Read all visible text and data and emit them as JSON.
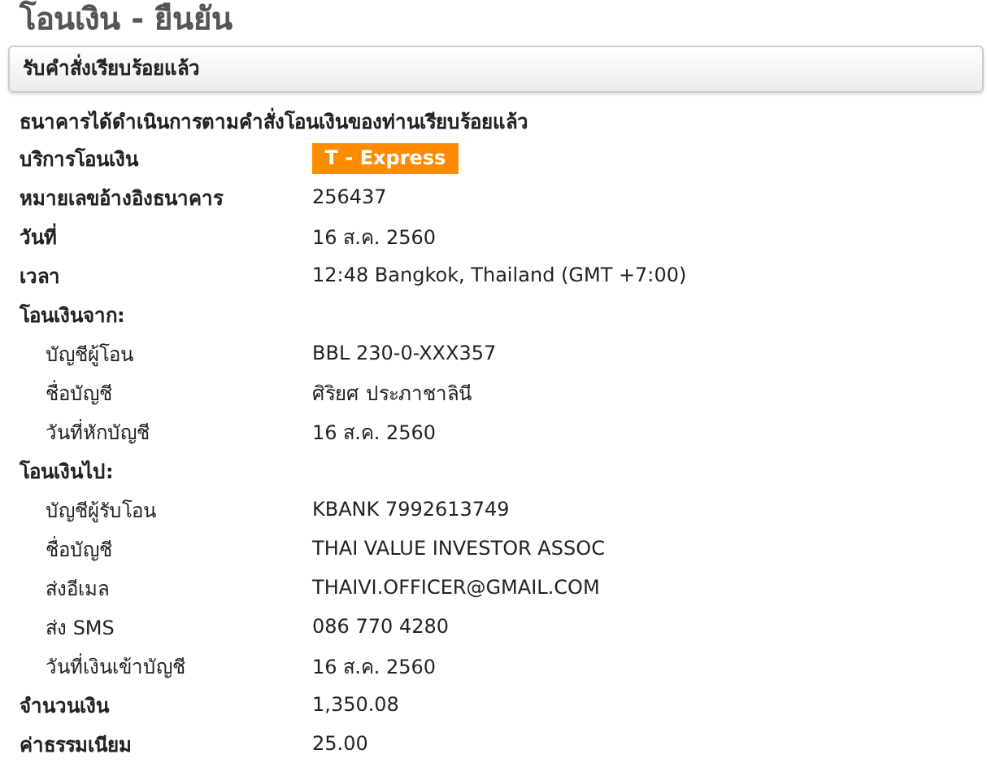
{
  "page_title": "โอนเงิน - ยืนยัน",
  "status_panel": {
    "text": "รับคำสั่งเรียบร้อยแล้ว"
  },
  "message": "ธนาคารได้ดำเนินการตามคำสั่งโอนเงินของท่านเรียบร้อยแล้ว",
  "rows": [
    {
      "kind": "badge",
      "label": "บริการโอนเงิน",
      "value": "T - Express"
    },
    {
      "kind": "field",
      "label": "หมายเลขอ้างอิงธนาคาร",
      "value": "256437"
    },
    {
      "kind": "field",
      "label": "วันที่",
      "value": "16 ส.ค. 2560"
    },
    {
      "kind": "field",
      "label": "เวลา",
      "value": "12:48 Bangkok, Thailand (GMT +7:00)"
    },
    {
      "kind": "heading",
      "label": "โอนเงินจาก:"
    },
    {
      "kind": "sub",
      "label": "บัญชีผู้โอน",
      "value": "BBL 230-0-XXX357"
    },
    {
      "kind": "sub",
      "label": "ชื่อบัญชี",
      "value": "ศิริยศ ประภาชาลินี"
    },
    {
      "kind": "sub",
      "label": "วันที่หักบัญชี",
      "value": "16 ส.ค. 2560"
    },
    {
      "kind": "heading",
      "label": "โอนเงินไป:"
    },
    {
      "kind": "sub",
      "label": "บัญชีผู้รับโอน",
      "value": "KBANK 7992613749"
    },
    {
      "kind": "sub",
      "label": "ชื่อบัญชี",
      "value": "THAI VALUE INVESTOR ASSOC"
    },
    {
      "kind": "sub",
      "label": "ส่งอีเมล",
      "value": "THAIVI.OFFICER@GMAIL.COM"
    },
    {
      "kind": "sub",
      "label": "ส่ง SMS",
      "value": "086 770 4280"
    },
    {
      "kind": "sub",
      "label": "วันที่เงินเข้าบัญชี",
      "value": "16 ส.ค. 2560"
    },
    {
      "kind": "field",
      "label": "จำนวนเงิน",
      "value": "1,350.08"
    },
    {
      "kind": "field",
      "label": "ค่าธรรมเนียม",
      "value": "25.00"
    }
  ]
}
